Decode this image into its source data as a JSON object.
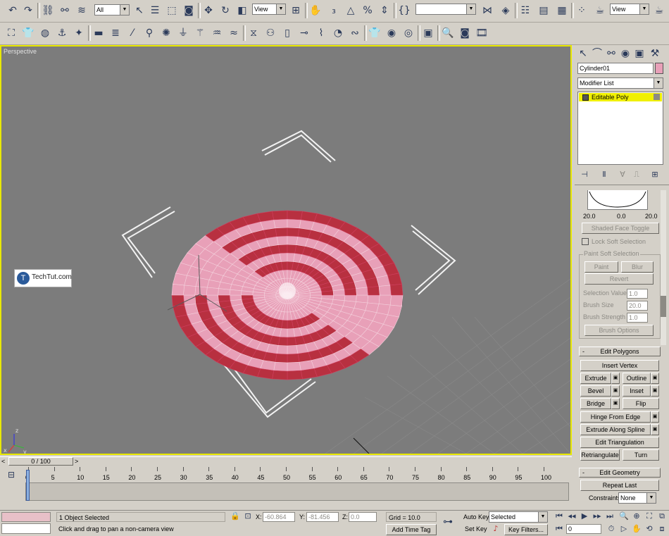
{
  "toolbar_main": {
    "selection_filter": "All",
    "reference_coord": "View",
    "named_selection": "",
    "view_dropdown": "View"
  },
  "viewport": {
    "label": "Perspective",
    "watermark": "TechTut.com"
  },
  "command_panel": {
    "object_name": "Cylinder01",
    "object_color": "#e8a0b8",
    "modifier_list": "Modifier List",
    "stack_item": "Editable Poly",
    "soft_selection": {
      "curve_left": "20.0",
      "curve_mid": "0.0",
      "curve_right": "20.0",
      "shaded_face_toggle": "Shaded Face Toggle",
      "lock_soft_selection": "Lock Soft Selection",
      "paint_group": "Paint Soft Selection",
      "paint": "Paint",
      "blur": "Blur",
      "revert": "Revert",
      "selection_value_label": "Selection Value",
      "selection_value": "1.0",
      "brush_size_label": "Brush Size",
      "brush_size": "20.0",
      "brush_strength_label": "Brush Strength",
      "brush_strength": "1.0",
      "brush_options": "Brush Options"
    },
    "edit_polygons": {
      "title": "Edit Polygons",
      "insert_vertex": "Insert Vertex",
      "extrude": "Extrude",
      "outline": "Outline",
      "bevel": "Bevel",
      "inset": "Inset",
      "bridge": "Bridge",
      "flip": "Flip",
      "hinge_from_edge": "Hinge From Edge",
      "extrude_along_spline": "Extrude Along Spline",
      "edit_triangulation": "Edit Triangulation",
      "retriangulate": "Retriangulate",
      "turn": "Turn"
    },
    "edit_geometry": {
      "title": "Edit Geometry",
      "repeat_last": "Repeat Last",
      "constraints_label": "Constraints:",
      "constraints_value": "None"
    }
  },
  "timeline": {
    "counter": "0 / 100",
    "ticks": [
      "0",
      "5",
      "10",
      "15",
      "20",
      "25",
      "30",
      "35",
      "40",
      "45",
      "50",
      "55",
      "60",
      "65",
      "70",
      "75",
      "80",
      "85",
      "90",
      "95",
      "100"
    ]
  },
  "status": {
    "selection": "1 Object Selected",
    "prompt": "Click and drag to pan a non-camera view",
    "x_label": "X:",
    "x": "-60.864",
    "y_label": "Y:",
    "y": "-81.456",
    "z_label": "Z:",
    "z": "0.0",
    "grid": "Grid = 10.0",
    "add_time_tag": "Add Time Tag",
    "auto_key": "Auto Key",
    "set_key": "Set Key",
    "key_mode": "Selected",
    "key_filters": "Key Filters...",
    "frame": "0"
  },
  "colors": {
    "viewport_bg": "#7c7c7c",
    "viewport_border": "#e8e800",
    "pink": "#e8a0b8",
    "red": "#b83040",
    "stack_highlight": "#f0f000"
  }
}
